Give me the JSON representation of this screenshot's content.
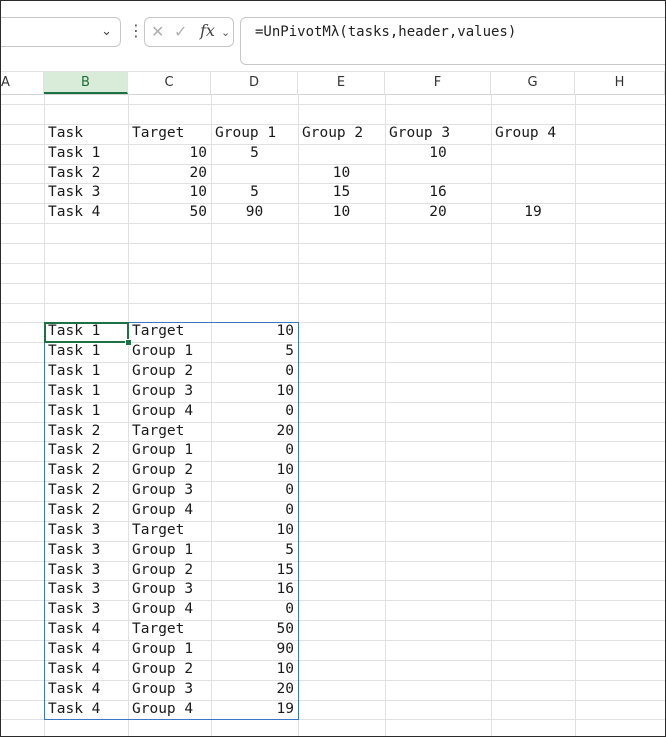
{
  "formula_bar": {
    "cancel_icon": "x-icon",
    "enter_icon": "check-icon",
    "fx_label": "fx",
    "formula": "=UnPivotMλ(tasks,header,values)"
  },
  "columns": [
    "A",
    "B",
    "C",
    "D",
    "E",
    "F",
    "G",
    "H"
  ],
  "selected_column": "B",
  "source_table": {
    "header": [
      "Task",
      "Target",
      "Group 1",
      "Group 2",
      "Group 3",
      "Group 4"
    ],
    "rows": [
      [
        "Task 1",
        "10",
        "5",
        "",
        "10",
        ""
      ],
      [
        "Task 2",
        "20",
        "",
        "10",
        "",
        ""
      ],
      [
        "Task 3",
        "10",
        "5",
        "15",
        "16",
        ""
      ],
      [
        "Task 4",
        "50",
        "90",
        "10",
        "20",
        "19"
      ]
    ]
  },
  "unpivot_result": [
    [
      "Task 1",
      "Target",
      "10"
    ],
    [
      "Task 1",
      "Group 1",
      "5"
    ],
    [
      "Task 1",
      "Group 2",
      "0"
    ],
    [
      "Task 1",
      "Group 3",
      "10"
    ],
    [
      "Task 1",
      "Group 4",
      "0"
    ],
    [
      "Task 2",
      "Target",
      "20"
    ],
    [
      "Task 2",
      "Group 1",
      "0"
    ],
    [
      "Task 2",
      "Group 2",
      "10"
    ],
    [
      "Task 2",
      "Group 3",
      "0"
    ],
    [
      "Task 2",
      "Group 4",
      "0"
    ],
    [
      "Task 3",
      "Target",
      "10"
    ],
    [
      "Task 3",
      "Group 1",
      "5"
    ],
    [
      "Task 3",
      "Group 2",
      "15"
    ],
    [
      "Task 3",
      "Group 3",
      "16"
    ],
    [
      "Task 3",
      "Group 4",
      "0"
    ],
    [
      "Task 4",
      "Target",
      "50"
    ],
    [
      "Task 4",
      "Group 1",
      "90"
    ],
    [
      "Task 4",
      "Group 2",
      "10"
    ],
    [
      "Task 4",
      "Group 3",
      "20"
    ],
    [
      "Task 4",
      "Group 4",
      "19"
    ]
  ]
}
